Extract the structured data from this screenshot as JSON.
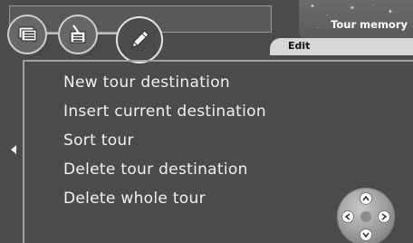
{
  "header": {
    "title": "Tour memory",
    "tabs": [
      {
        "icon": "list-icon"
      },
      {
        "icon": "insert-icon"
      },
      {
        "icon": "pencil-icon",
        "active": true
      }
    ],
    "active_tab_label": "Edit"
  },
  "menu": {
    "items": [
      {
        "label": "New tour destination"
      },
      {
        "label": "Insert current destination"
      },
      {
        "label": "Sort tour"
      },
      {
        "label": "Delete tour destination"
      },
      {
        "label": "Delete whole tour"
      }
    ]
  },
  "navigation": {
    "left_arrow_icon": "left-arrow-icon",
    "joystick_icons": [
      "up-arrow-icon",
      "down-arrow-icon",
      "left-arrow-icon",
      "right-arrow-icon"
    ]
  },
  "colors": {
    "background": "#4b4b4b",
    "text": "#f2f2f2",
    "tab_strip": "#d7d7d7"
  }
}
